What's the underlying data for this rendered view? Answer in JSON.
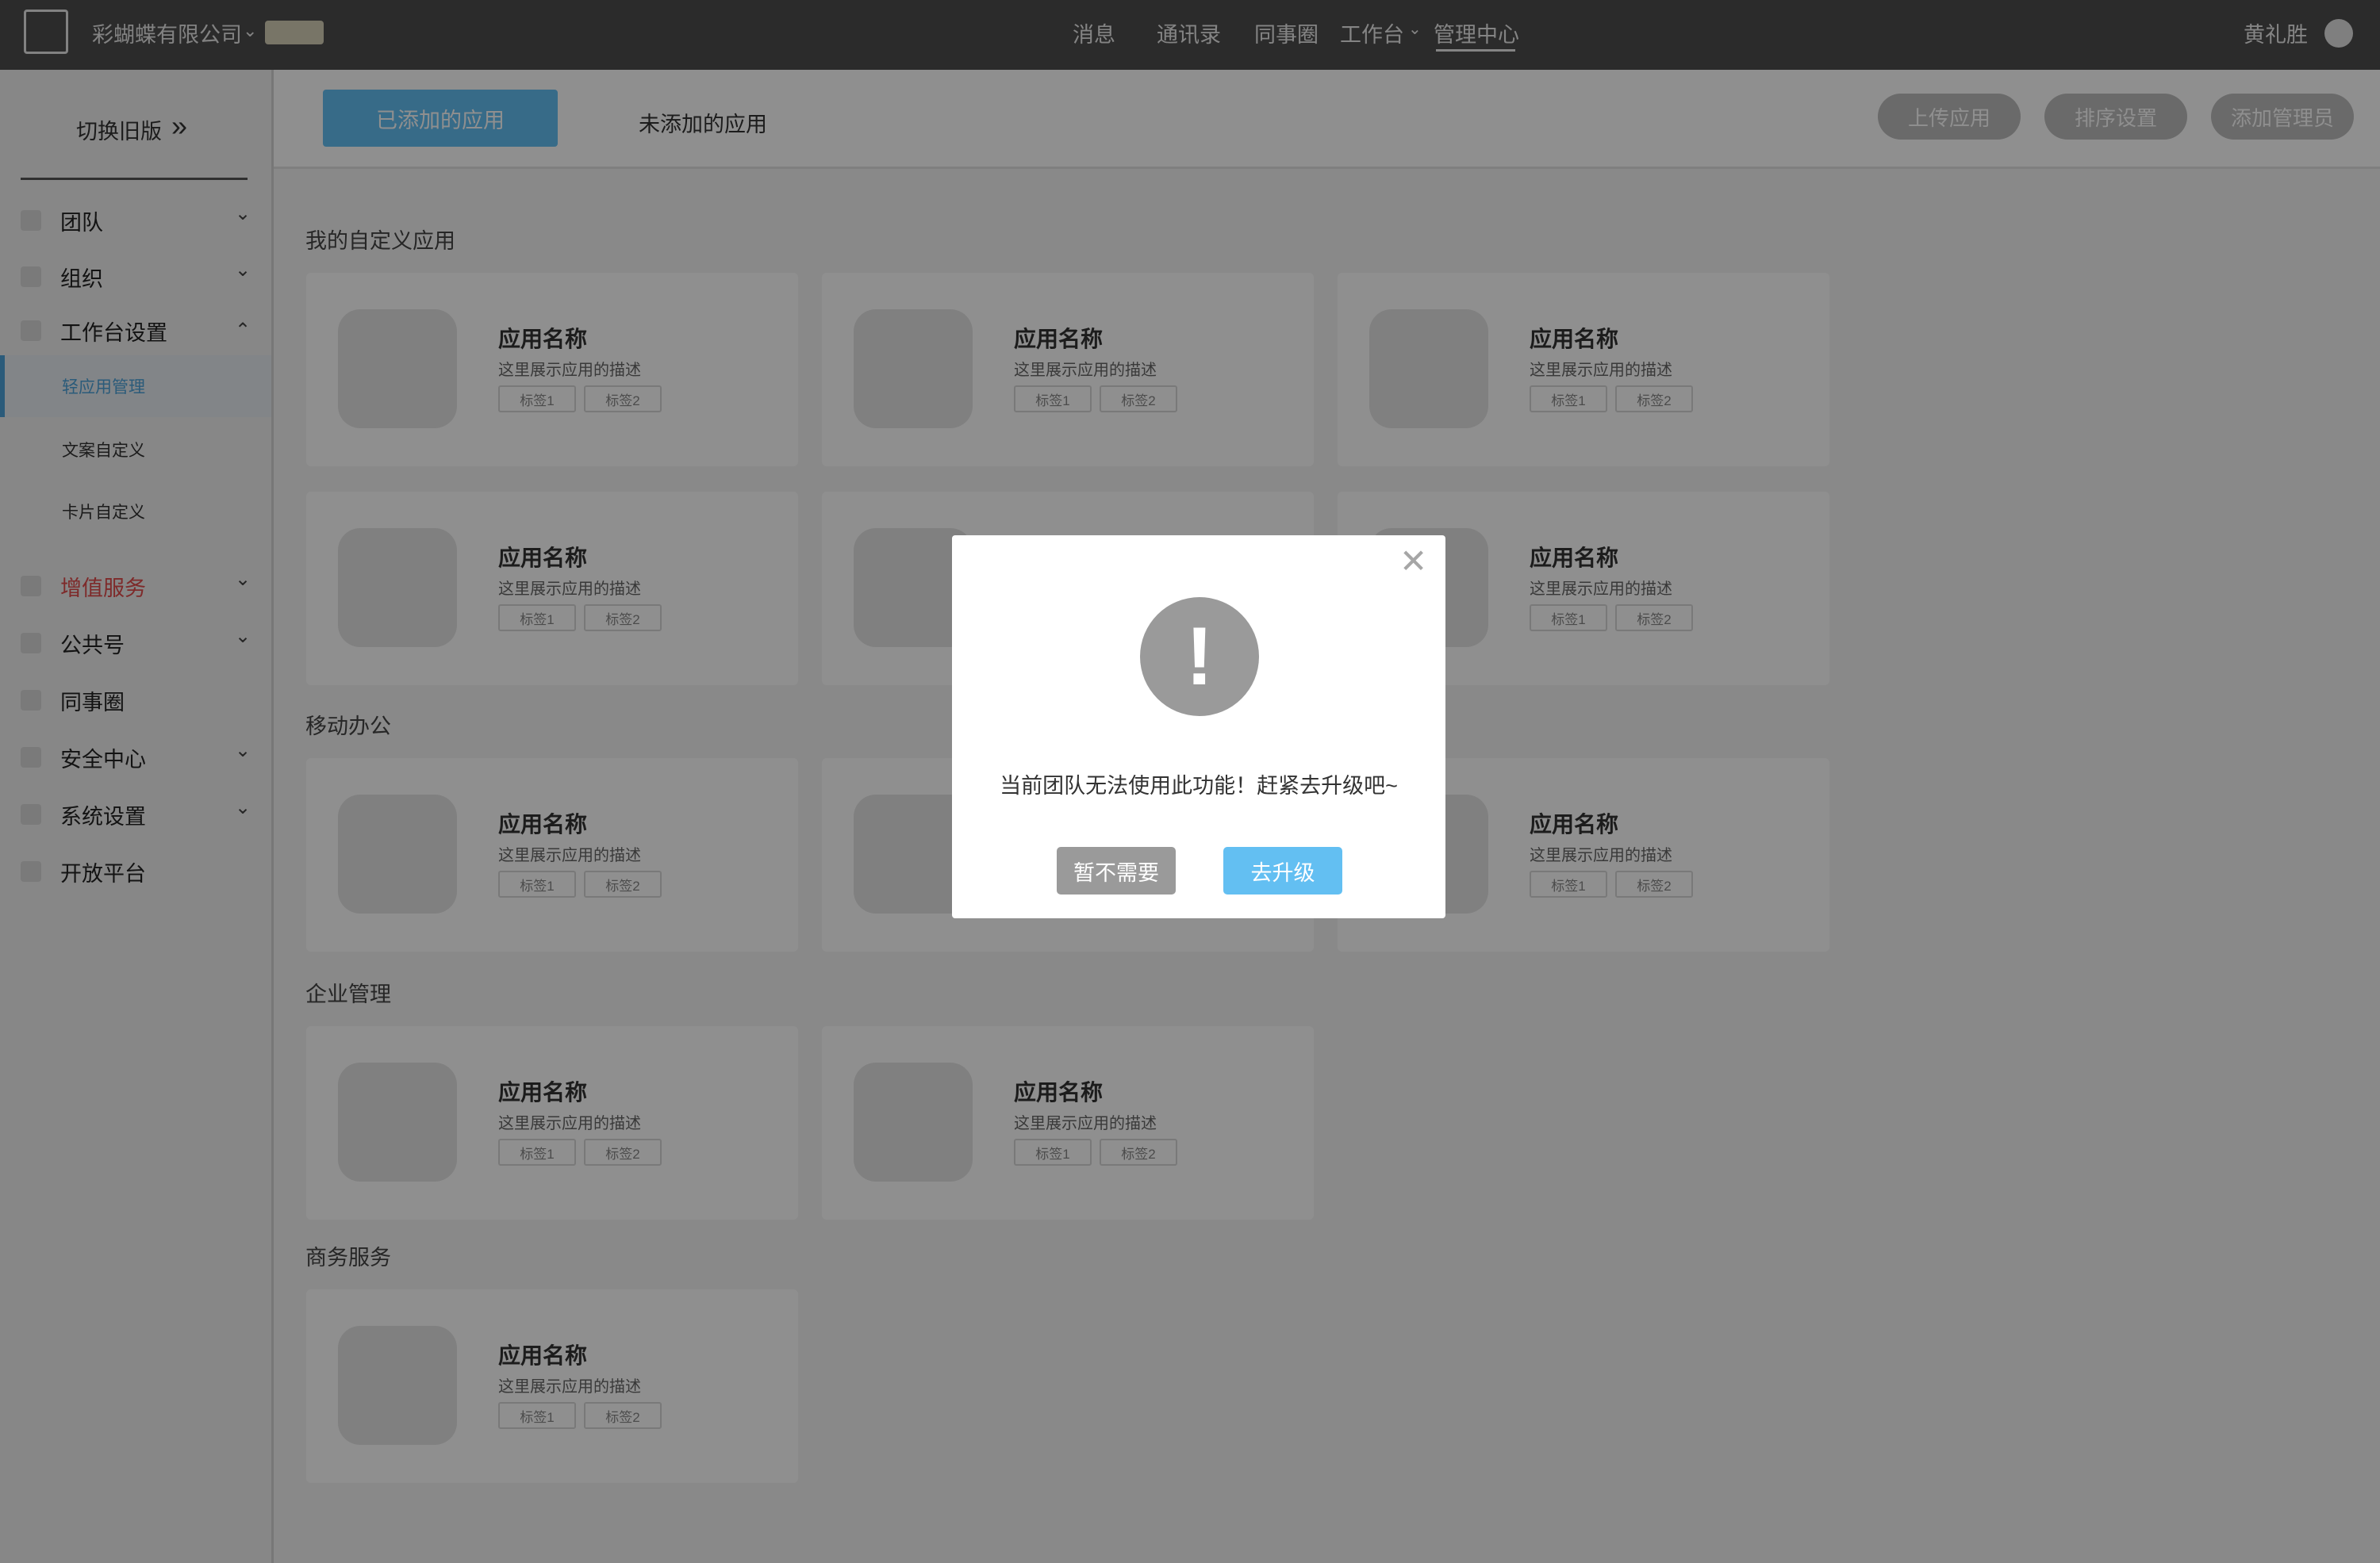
{
  "topbar": {
    "company": "彩蝴蝶有限公司",
    "nav": [
      {
        "label": "消息"
      },
      {
        "label": "通讯录"
      },
      {
        "label": "同事圈"
      },
      {
        "label": "工作台"
      },
      {
        "label": "管理中心"
      }
    ],
    "user": "黄礼胜"
  },
  "sidebar": {
    "switch_old": "切换旧版",
    "items": [
      {
        "label": "团队",
        "icon": "chevron-down-icon"
      },
      {
        "label": "组织",
        "icon": "chevron-down-icon"
      },
      {
        "label": "工作台设置",
        "icon": "chevron-up-icon"
      },
      {
        "label": "增值服务",
        "icon": "chevron-down-icon",
        "color": "#e04b4b"
      },
      {
        "label": "公共号",
        "icon": "chevron-down-icon"
      },
      {
        "label": "同事圈"
      },
      {
        "label": "安全中心",
        "icon": "chevron-down-icon"
      },
      {
        "label": "系统设置",
        "icon": "chevron-down-icon"
      },
      {
        "label": "开放平台"
      }
    ],
    "subitems": [
      {
        "label": "轻应用管理",
        "active": true
      },
      {
        "label": "文案自定义"
      },
      {
        "label": "卡片自定义"
      }
    ]
  },
  "tabs": {
    "added": "已添加的应用",
    "not_added": "未添加的应用"
  },
  "actions": {
    "upload": "上传应用",
    "sort": "排序设置",
    "add_admin": "添加管理员"
  },
  "card": {
    "name": "应用名称",
    "desc": "这里展示应用的描述",
    "tag1": "标签1",
    "tag2": "标签2"
  },
  "sections": [
    {
      "title": "我的自定义应用"
    },
    {
      "title": "移动办公"
    },
    {
      "title": "企业管理"
    },
    {
      "title": "商务服务"
    }
  ],
  "modal": {
    "icon": "exclamation-icon",
    "message": "当前团队无法使用此功能！赶紧去升级吧~",
    "cancel": "暂不需要",
    "upgrade": "去升级"
  },
  "colors": {
    "accent": "#63bff2",
    "topbar": "#4d4d4d",
    "warning_red": "#e04b4b"
  }
}
